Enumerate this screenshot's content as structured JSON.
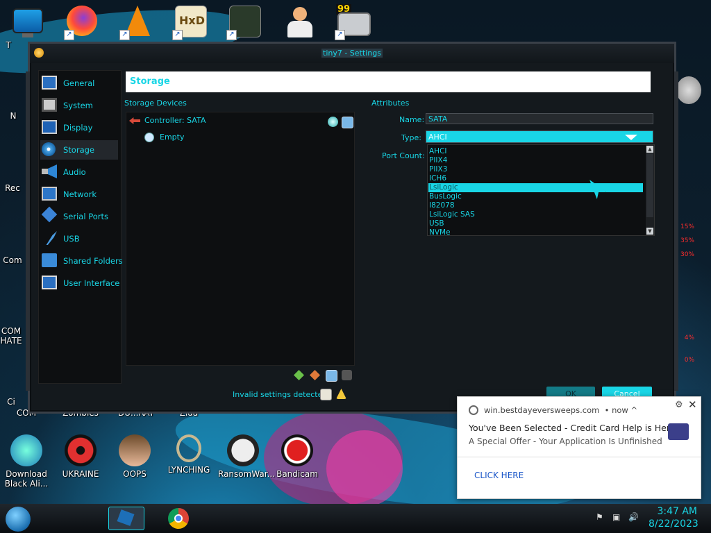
{
  "window": {
    "title": "tiny7 - Settings"
  },
  "sidebar": {
    "items": [
      {
        "label": "General"
      },
      {
        "label": "System"
      },
      {
        "label": "Display"
      },
      {
        "label": "Storage",
        "selected": true
      },
      {
        "label": "Audio"
      },
      {
        "label": "Network"
      },
      {
        "label": "Serial Ports"
      },
      {
        "label": "USB"
      },
      {
        "label": "Shared Folders"
      },
      {
        "label": "User Interface"
      }
    ]
  },
  "page": {
    "title": "Storage"
  },
  "storage_devices": {
    "label": "Storage Devices",
    "controller": "Controller: SATA",
    "items": [
      "Empty"
    ]
  },
  "attributes": {
    "label": "Attributes",
    "name_label": "Name:",
    "name_value": "SATA",
    "type_label": "Type:",
    "type_value": "AHCI",
    "port_count_label": "Port Count:",
    "type_options": [
      "AHCI",
      "PIIX4",
      "PIIX3",
      "ICH6",
      "LsiLogic",
      "BusLogic",
      "I82078",
      "LsiLogic SAS",
      "USB",
      "NVMe"
    ],
    "highlighted_option": "LsiLogic"
  },
  "footer": {
    "status": "Invalid settings detected",
    "ok_label": "OK",
    "cancel_label": "Cancel"
  },
  "desktop": {
    "bottom_icons": [
      "Download Black Ali...",
      "UKRAINE",
      "OOPS",
      "LYNCHING",
      "RansomWar...",
      "Bandicam"
    ],
    "partial_labels": [
      "COM HATE",
      "Com",
      "Rec",
      "N",
      "T",
      "Ci",
      "COM",
      "Zombies",
      "DU...RAT",
      "Zida"
    ],
    "hud_percents": [
      "15%",
      "35%",
      "30%",
      "4%",
      "0%"
    ]
  },
  "notification": {
    "source": "win.bestdayeversweeps.com",
    "when": "• now ^",
    "title": "You've Been Selected - Credit Card Help is Here",
    "body": "A Special Offer - Your Application Is Unfinished",
    "action": "CLICK HERE"
  },
  "taskbar": {
    "time": "3:47 AM",
    "date": "8/22/2023"
  },
  "colors": {
    "accent": "#19d6e6",
    "window_bg": "#14191d",
    "panel_bg": "#0d0f11"
  }
}
